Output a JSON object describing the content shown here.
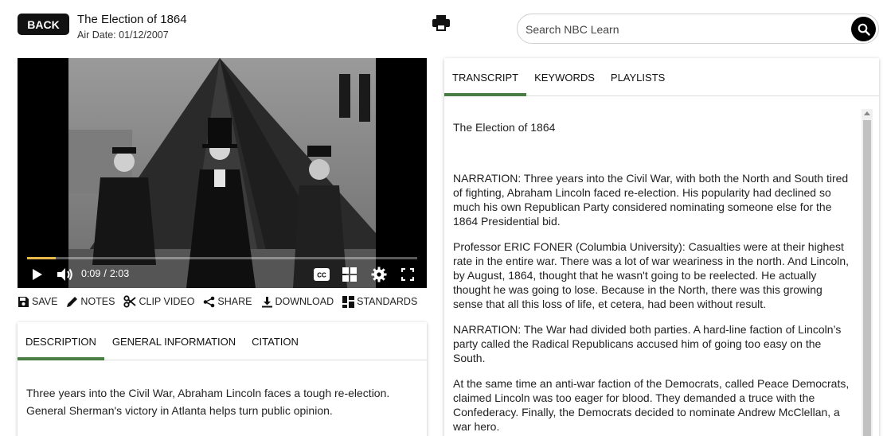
{
  "header": {
    "back_label": "BACK",
    "title": "The Election of 1864",
    "air_date_label": "Air Date:",
    "air_date": "01/12/2007"
  },
  "search": {
    "placeholder": "Search NBC Learn"
  },
  "player": {
    "current_time": "0:09",
    "separator": "/",
    "duration": "2:03",
    "progress_fraction": 0.073
  },
  "actions": {
    "save": "SAVE",
    "notes": "NOTES",
    "clip_video": "CLIP VIDEO",
    "share": "SHARE",
    "download": "DOWNLOAD",
    "standards": "STANDARDS"
  },
  "description_panel": {
    "tabs": [
      "DESCRIPTION",
      "GENERAL INFORMATION",
      "CITATION"
    ],
    "active_tab": "DESCRIPTION",
    "text": "Three years into the Civil War, Abraham Lincoln faces a tough re-election. General Sherman's victory in Atlanta helps turn public opinion."
  },
  "transcript_panel": {
    "tabs": [
      "TRANSCRIPT",
      "KEYWORDS",
      "PLAYLISTS"
    ],
    "active_tab": "TRANSCRIPT",
    "title": "The Election of 1864",
    "paragraphs": [
      "NARRATION: Three years into the Civil War, with both the North and South tired of fighting, Abraham Lincoln faced re-election. His popularity had declined so much his own Republican Party considered nominating someone else for the 1864 Presidential bid.",
      "Professor ERIC FONER (Columbia University): Casualties were at their highest rate in the entire war. There was a lot of war weariness in the north. And Lincoln, by August, 1864, thought that he wasn't going to be reelected. He actually thought he was going to lose. Because in the North, there was this growing sense that all this loss of life, et cetera, had been without result.",
      "NARRATION: The War had divided both parties. A hard-line faction of Lincoln’s party called the Radical Republicans accused him of going too easy on the South.",
      "At the same time an anti-war faction of the Democrats, called Peace Democrats, claimed Lincoln was too eager for blood. They demanded a truce with the Confederacy. Finally, the Democrats decided to nominate Andrew McClellan, a war hero."
    ]
  },
  "colors": {
    "accent_green": "#4a7d44",
    "progress": "#e8b84a",
    "button_black": "#111111"
  }
}
